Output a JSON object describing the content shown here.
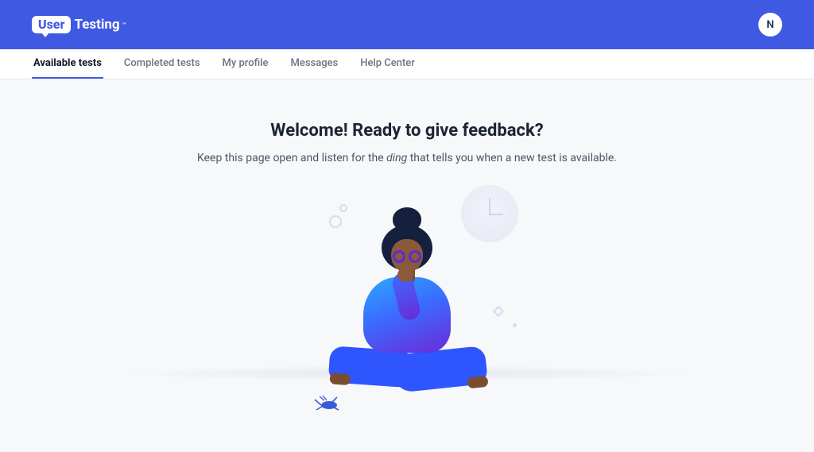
{
  "brand": {
    "badge": "User",
    "word": "Testing",
    "tm": "™"
  },
  "user": {
    "initial": "N"
  },
  "nav": {
    "items": [
      {
        "label": "Available tests",
        "active": true
      },
      {
        "label": "Completed tests",
        "active": false
      },
      {
        "label": "My profile",
        "active": false
      },
      {
        "label": "Messages",
        "active": false
      },
      {
        "label": "Help Center",
        "active": false
      }
    ]
  },
  "hero": {
    "title": "Welcome! Ready to give feedback?",
    "sub_pre": "Keep this page open and listen for the ",
    "sub_em": "ding",
    "sub_post": " that tells you when a new test is available."
  }
}
